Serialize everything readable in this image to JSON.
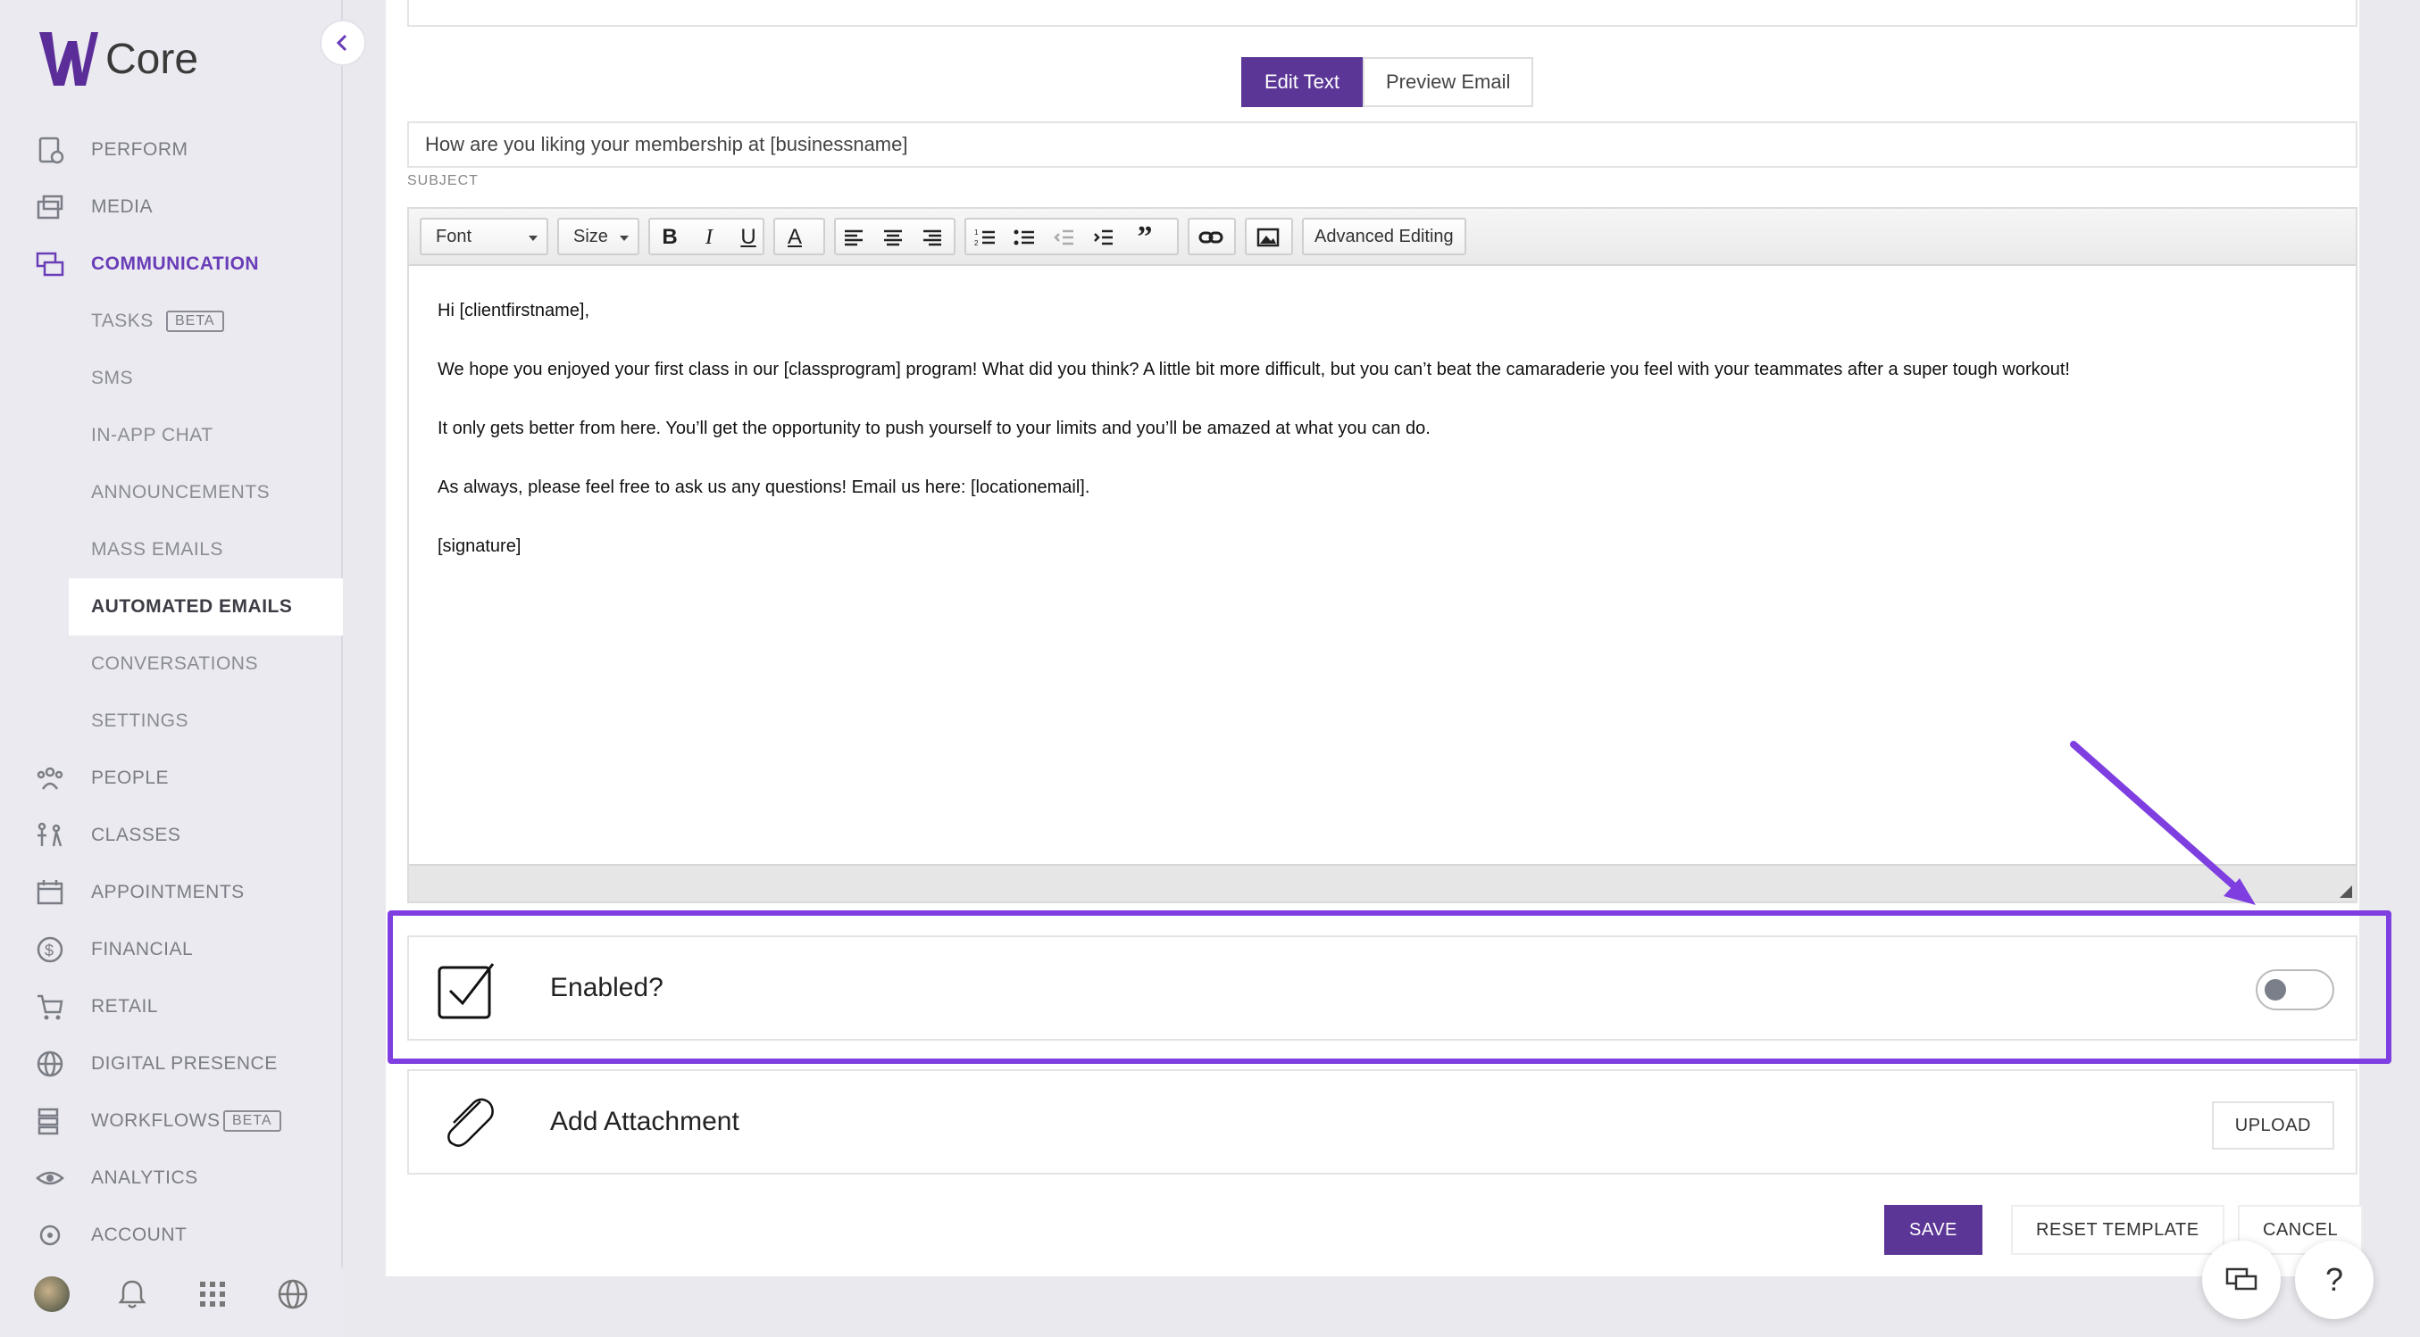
{
  "app": {
    "name": "Core"
  },
  "sidebar": {
    "items": [
      {
        "label": "PERFORM",
        "icon": "perform-icon"
      },
      {
        "label": "MEDIA",
        "icon": "media-icon"
      },
      {
        "label": "COMMUNICATION",
        "icon": "communication-icon",
        "active": true
      },
      {
        "label": "TASKS",
        "badge": "BETA",
        "sub": true
      },
      {
        "label": "SMS",
        "sub": true
      },
      {
        "label": "IN-APP CHAT",
        "sub": true
      },
      {
        "label": "ANNOUNCEMENTS",
        "sub": true
      },
      {
        "label": "MASS EMAILS",
        "sub": true
      },
      {
        "label": "AUTOMATED EMAILS",
        "sub": true,
        "selected": true
      },
      {
        "label": "CONVERSATIONS",
        "sub": true
      },
      {
        "label": "SETTINGS",
        "sub": true
      },
      {
        "label": "PEOPLE",
        "icon": "people-icon"
      },
      {
        "label": "CLASSES",
        "icon": "classes-icon"
      },
      {
        "label": "APPOINTMENTS",
        "icon": "appointments-icon"
      },
      {
        "label": "FINANCIAL",
        "icon": "financial-icon"
      },
      {
        "label": "RETAIL",
        "icon": "retail-icon"
      },
      {
        "label": "DIGITAL PRESENCE",
        "icon": "globe-icon"
      },
      {
        "label": "WORKFLOWS",
        "badge": "BETA",
        "icon": "workflows-icon"
      },
      {
        "label": "ANALYTICS",
        "icon": "analytics-icon"
      },
      {
        "label": "ACCOUNT",
        "icon": "account-icon"
      }
    ]
  },
  "editor_mode": {
    "edit_label": "Edit Text",
    "preview_label": "Preview Email"
  },
  "subject": {
    "value": "How are you liking your membership at [businessname]",
    "label": "SUBJECT"
  },
  "toolbar": {
    "font_label": "Font",
    "size_label": "Size",
    "advanced_label": "Advanced Editing"
  },
  "body": {
    "paragraphs": [
      "Hi [clientfirstname],",
      "We hope you enjoyed your first class in our [classprogram] program! What did you think? A little bit more difficult, but you can’t beat the camaraderie you feel with your teammates after a super tough workout!",
      "It only gets better from here. You’ll get the opportunity to push yourself to your limits and you’ll be amazed at what you can do.",
      "As always, please feel free to ask us any questions! Email us here: [locationemail].",
      "[signature]"
    ]
  },
  "enabled_row": {
    "label": "Enabled?",
    "enabled": false
  },
  "attachment_row": {
    "label": "Add Attachment",
    "upload_label": "UPLOAD"
  },
  "actions": {
    "save": "SAVE",
    "reset": "RESET TEMPLATE",
    "cancel": "CANCEL"
  },
  "colors": {
    "accent": "#5b3696",
    "highlight": "#7f3fe0",
    "active_nav": "#6a3db8"
  }
}
